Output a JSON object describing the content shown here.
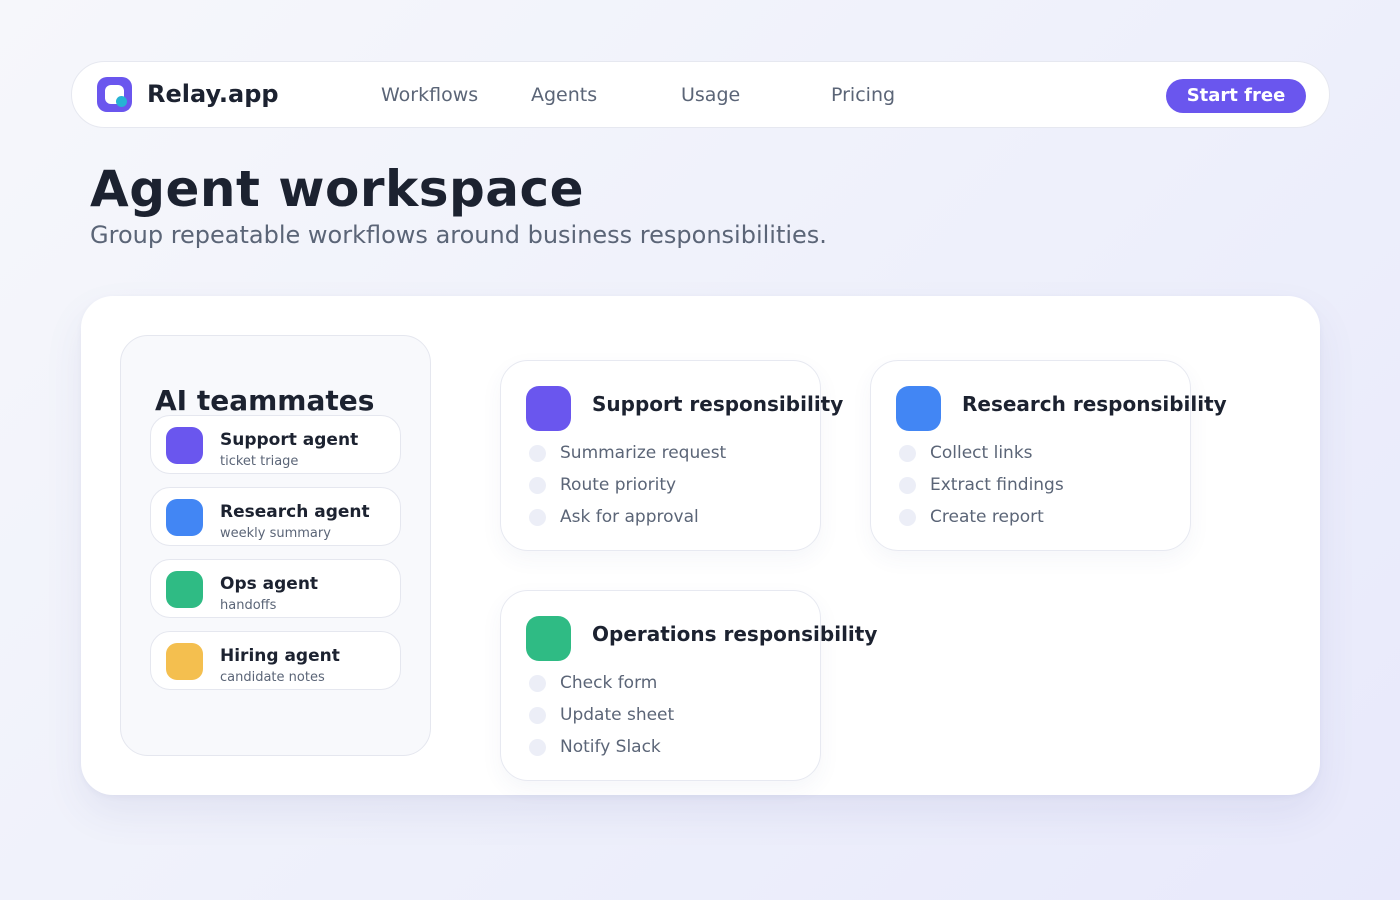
{
  "nav": {
    "brand": "Relay.app",
    "links": [
      "Workflows",
      "Agents",
      "Usage",
      "Pricing"
    ],
    "cta": "Start free"
  },
  "hero": {
    "title": "Agent workspace",
    "subtitle": "Group repeatable workflows around business responsibilities."
  },
  "team": {
    "title": "AI teammates",
    "agents": [
      {
        "name": "Support agent",
        "desc": "ticket triage",
        "color": "#6a56ee"
      },
      {
        "name": "Research agent",
        "desc": "weekly summary",
        "color": "#4286f4"
      },
      {
        "name": "Ops agent",
        "desc": "handoffs",
        "color": "#2fbb84"
      },
      {
        "name": "Hiring agent",
        "desc": "candidate notes",
        "color": "#f4bf4f"
      }
    ]
  },
  "responsibilities": [
    {
      "title": "Support responsibility",
      "color": "#6a56ee",
      "steps": [
        "Summarize request",
        "Route priority",
        "Ask for approval"
      ]
    },
    {
      "title": "Research responsibility",
      "color": "#4286f4",
      "steps": [
        "Collect links",
        "Extract findings",
        "Create report"
      ]
    },
    {
      "title": "Operations responsibility",
      "color": "#2fbb84",
      "steps": [
        "Check form",
        "Update sheet",
        "Notify Slack"
      ]
    }
  ],
  "colors": {
    "accent": "#6a56ee",
    "logo_dot": "#26b3d4"
  }
}
